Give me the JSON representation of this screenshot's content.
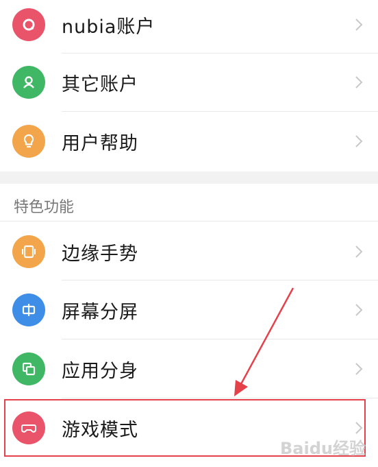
{
  "items_top": [
    {
      "label": "nubia账户",
      "color": "#e9546b",
      "icon": "nubia-account-icon"
    },
    {
      "label": "其它账户",
      "color": "#3fb764",
      "icon": "other-account-icon"
    },
    {
      "label": "用户帮助",
      "color": "#f2a54a",
      "icon": "lightbulb-icon"
    }
  ],
  "section": {
    "title": "特色功能"
  },
  "items_feature": [
    {
      "label": "边缘手势",
      "color": "#f2a54a",
      "icon": "edge-gesture-icon"
    },
    {
      "label": "屏幕分屏",
      "color": "#3e8ee8",
      "icon": "split-screen-icon"
    },
    {
      "label": "应用分身",
      "color": "#3fb764",
      "icon": "app-clone-icon"
    },
    {
      "label": "游戏模式",
      "color": "#e9546b",
      "icon": "gamepad-icon"
    }
  ],
  "highlight_color": "#e5414b",
  "watermark": "Baidu经验"
}
